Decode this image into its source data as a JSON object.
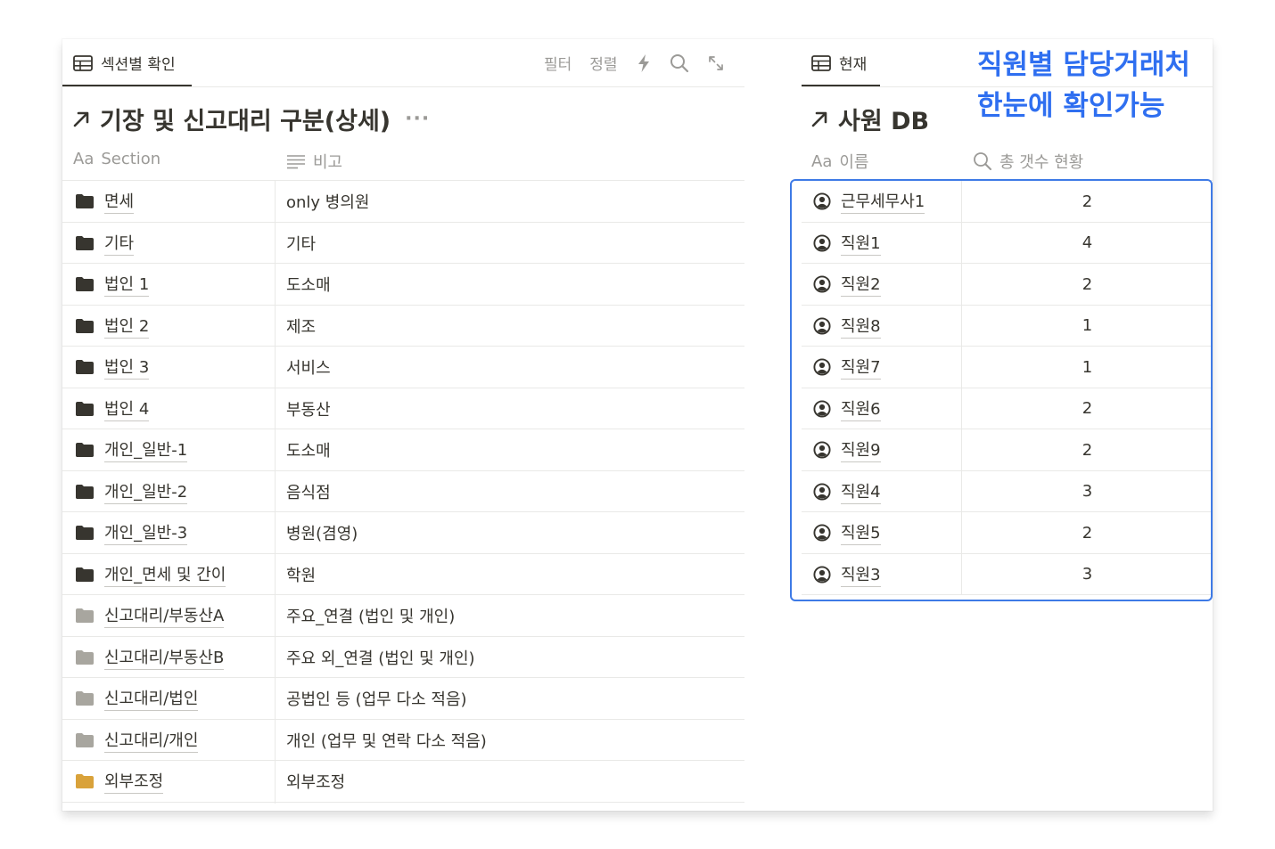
{
  "left_view": {
    "tab_label": "섹션별 확인",
    "toolbar": {
      "filter": "필터",
      "sort": "정렬"
    },
    "title": "기장 및 신고대리 구분(상세)",
    "more": "···",
    "columns": {
      "section": "Section",
      "note": "비고",
      "aa": "Aa"
    },
    "rows": [
      {
        "name": "면세",
        "note": "only 병의원",
        "folder_color": "#37352f"
      },
      {
        "name": "기타",
        "note": "기타",
        "folder_color": "#37352f"
      },
      {
        "name": "법인 1",
        "note": "도소매",
        "folder_color": "#37352f"
      },
      {
        "name": "법인 2",
        "note": "제조",
        "folder_color": "#37352f"
      },
      {
        "name": "법인 3",
        "note": "서비스",
        "folder_color": "#37352f"
      },
      {
        "name": "법인 4",
        "note": "부동산",
        "folder_color": "#37352f"
      },
      {
        "name": "개인_일반-1",
        "note": "도소매",
        "folder_color": "#37352f"
      },
      {
        "name": "개인_일반-2",
        "note": "음식점",
        "folder_color": "#37352f"
      },
      {
        "name": "개인_일반-3",
        "note": "병원(겸영)",
        "folder_color": "#37352f"
      },
      {
        "name": "개인_면세 및 간이",
        "note": "학원",
        "folder_color": "#37352f"
      },
      {
        "name": "신고대리/부동산A",
        "note": "주요_연결 (법인 및 개인)",
        "folder_color": "#a8a69f"
      },
      {
        "name": "신고대리/부동산B",
        "note": "주요 외_연결 (법인 및 개인)",
        "folder_color": "#a8a69f"
      },
      {
        "name": "신고대리/법인",
        "note": "공법인 등 (업무 다소 적음)",
        "folder_color": "#a8a69f"
      },
      {
        "name": "신고대리/개인",
        "note": "개인 (업무 및 연락 다소 적음)",
        "folder_color": "#a8a69f"
      },
      {
        "name": "외부조정",
        "note": "외부조정",
        "folder_color": "#d9a23a"
      }
    ]
  },
  "right_view": {
    "tab_label": "현재",
    "title": "사원 DB",
    "columns": {
      "name": "이름",
      "count": "총 갯수 현황",
      "aa": "Aa"
    },
    "rows": [
      {
        "name": "근무세무사1",
        "count": "2"
      },
      {
        "name": "직원1",
        "count": "4"
      },
      {
        "name": "직원2",
        "count": "2"
      },
      {
        "name": "직원8",
        "count": "1"
      },
      {
        "name": "직원7",
        "count": "1"
      },
      {
        "name": "직원6",
        "count": "2"
      },
      {
        "name": "직원9",
        "count": "2"
      },
      {
        "name": "직원4",
        "count": "3"
      },
      {
        "name": "직원5",
        "count": "2"
      },
      {
        "name": "직원3",
        "count": "3"
      }
    ]
  },
  "annotation": {
    "line1": "직원별 담당거래처",
    "line2": "한눈에 확인가능",
    "color": "#2f6ff0"
  }
}
